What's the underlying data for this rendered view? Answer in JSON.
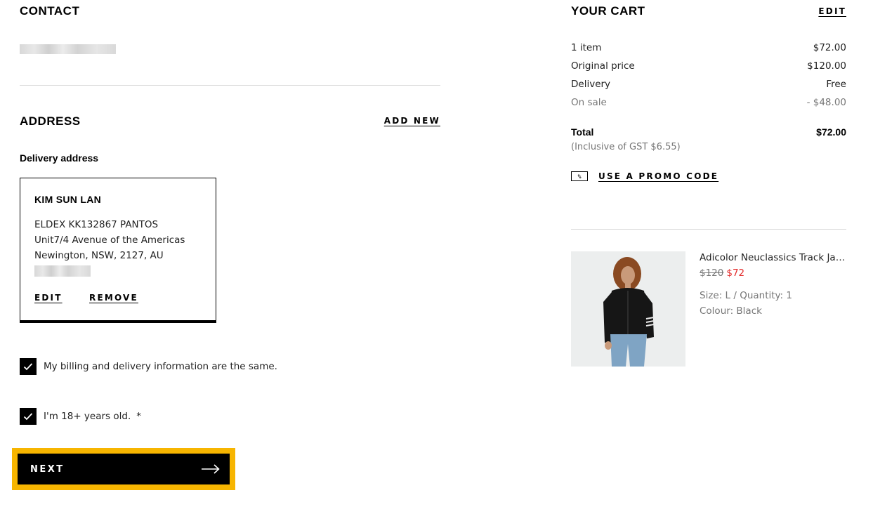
{
  "contact": {
    "title": "CONTACT"
  },
  "address": {
    "title": "ADDRESS",
    "add_new_label": "ADD NEW",
    "delivery_label": "Delivery address",
    "card": {
      "name": "KIM SUN LAN",
      "lines": [
        "ELDEX KK132867 PANTOS",
        "Unit7/4 Avenue of the Americas",
        "Newington, NSW, 2127, AU"
      ],
      "edit_label": "EDIT",
      "remove_label": "REMOVE"
    }
  },
  "checkboxes": [
    {
      "label": "My billing and delivery information are the same.",
      "checked": true
    },
    {
      "label": "I'm 18+ years old.",
      "required_mark": "*",
      "checked": true
    }
  ],
  "next_button": {
    "label": "NEXT",
    "icon": "arrow-right-icon"
  },
  "cart": {
    "title": "YOUR CART",
    "edit_label": "EDIT",
    "summary": [
      {
        "label": "1 item",
        "value": "$72.00",
        "muted": false
      },
      {
        "label": "Original price",
        "value": "$120.00",
        "muted": false
      },
      {
        "label": "Delivery",
        "value": "Free",
        "muted": false
      },
      {
        "label": "On sale",
        "value": "- $48.00",
        "muted": true
      }
    ],
    "total_label": "Total",
    "total_value": "$72.00",
    "gst_note": "(Inclusive of GST  $6.55)",
    "promo_label": "USE A PROMO CODE",
    "promo_icon_text": "%",
    "product": {
      "name": "Adicolor Neuclassics Track Jacket",
      "old_price": "$120",
      "new_price": "$72",
      "size_qty": "Size: L / Quantity: 1",
      "colour": "Colour: Black"
    }
  },
  "colors": {
    "accent_focus": "#f7b500",
    "sale_red": "#e32b2b",
    "muted_text": "#767676",
    "divider": "#d9d9d9"
  }
}
